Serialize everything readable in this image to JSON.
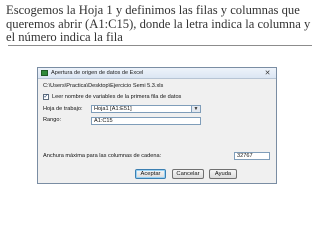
{
  "slide": {
    "text": "Escogemos la Hoja 1 y definimos las filas y columnas que queremos abrir (A1:C15), donde la letra indica la columna y el número indica la fila"
  },
  "dialog": {
    "title": "Apertura de origen de datos de Excel",
    "close_glyph": "✕",
    "file_path": "C:\\Users\\Practica\\Desktop\\Ejercicio Semi 5.3.xls",
    "checkbox_label": "Leer nombre de variables de la primera fila de datos",
    "checkbox_checked": true,
    "sheet_label": "Hoja de trabajo:",
    "sheet_value": "Hoja1 [A1:E51]",
    "range_label": "Rango:",
    "range_value": "A1:C15",
    "maxwidth_label": "Anchura máxima para las columnas de cadena:",
    "maxwidth_value": "32767",
    "buttons": {
      "accept": "Aceptar",
      "cancel": "Cancelar",
      "help": "Ayuda"
    }
  },
  "icons": {
    "app": "excel-data-source-icon",
    "close": "close-icon",
    "checkbox": "checkmark-icon",
    "dropdown": "chevron-down-icon"
  },
  "colors": {
    "slide_text": "#333333",
    "dialog_bg": "#f0f0f0",
    "default_button_border": "#3c7fb1"
  }
}
